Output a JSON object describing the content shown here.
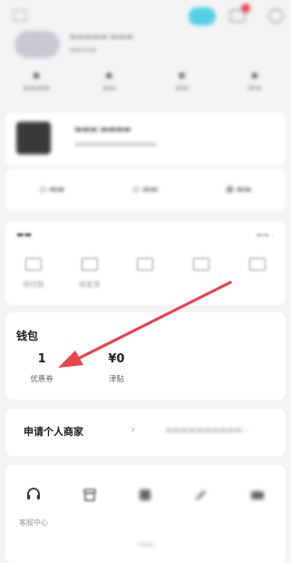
{
  "wallet": {
    "title": "钱包",
    "items": [
      {
        "value": "1",
        "label": "优惠券"
      },
      {
        "value": "¥0",
        "label": "津贴"
      },
      {
        "value": "",
        "label": ""
      },
      {
        "value": "",
        "label": ""
      }
    ]
  },
  "merchant": {
    "label": "申请个人商家",
    "arrow": "›"
  },
  "services": {
    "items": [
      {
        "label": "客服中心",
        "icon": "headset-icon"
      },
      {
        "label": "",
        "icon": "shop-icon"
      },
      {
        "label": "",
        "icon": "grid-icon"
      },
      {
        "label": "",
        "icon": "pen-icon"
      },
      {
        "label": "",
        "icon": "card-icon"
      }
    ]
  },
  "orders": {
    "items": [
      {
        "label": "待付款",
        "icon": "wallet-icon"
      },
      {
        "label": "待发货",
        "icon": "box-icon"
      },
      {
        "label": "",
        "icon": "truck-icon"
      },
      {
        "label": "",
        "icon": "comment-icon"
      },
      {
        "label": "",
        "icon": "refund-icon"
      }
    ]
  },
  "colors": {
    "annotation_arrow": "#e8434e",
    "promo": "#56d0e6",
    "badge": "#f0425c"
  }
}
